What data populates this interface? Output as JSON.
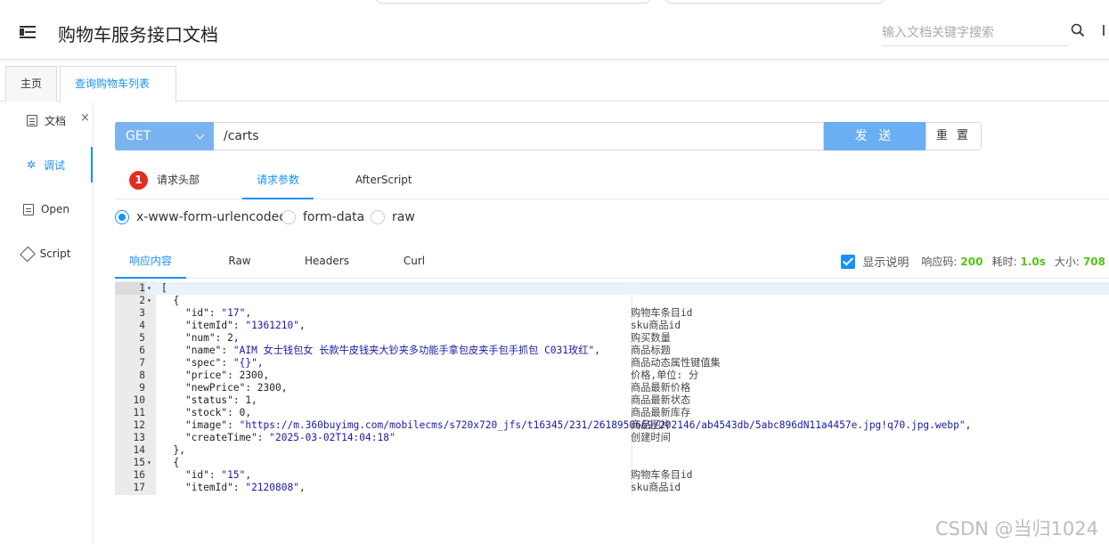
{
  "header": {
    "title": "购物车服务接口文档",
    "search_placeholder": "输入文档关键字搜索"
  },
  "tabs": {
    "home": "主页",
    "active": "查询购物车列表",
    "close": "×"
  },
  "sidebar": {
    "items": [
      {
        "label": "文档",
        "icon": "doc-icon"
      },
      {
        "label": "调试",
        "icon": "bug-icon"
      },
      {
        "label": "Open",
        "icon": "file-icon"
      },
      {
        "label": "Script",
        "icon": "cube-icon"
      }
    ]
  },
  "request": {
    "method": "GET",
    "url": "/carts",
    "send_label": "发 送",
    "reset_label": "重 置"
  },
  "subtabs": {
    "badge": "1",
    "headers": "请求头部",
    "params": "请求参数",
    "after": "AfterScript"
  },
  "body_types": {
    "urlencoded": "x-www-form-urlencoded",
    "formdata": "form-data",
    "raw": "raw"
  },
  "response_tabs": {
    "content": "响应内容",
    "raw": "Raw",
    "headers": "Headers",
    "curl": "Curl"
  },
  "response_meta": {
    "show_desc": "显示说明",
    "code_label": "响应码:",
    "code": "200",
    "time_label": "耗时:",
    "time": "1.0s",
    "size_label": "大小:",
    "size": "708"
  },
  "code_lines": [
    {
      "n": "1",
      "fold": "▾",
      "text": "[",
      "comment": ""
    },
    {
      "n": "2",
      "fold": "▾",
      "text": "  {",
      "comment": ""
    },
    {
      "n": "3",
      "fold": "",
      "text": "    \"id\": \"17\",",
      "comment": "购物车条目id"
    },
    {
      "n": "4",
      "fold": "",
      "text": "    \"itemId\": \"1361210\",",
      "comment": "sku商品id"
    },
    {
      "n": "5",
      "fold": "",
      "text": "    \"num\": 2,",
      "comment": "购买数量"
    },
    {
      "n": "6",
      "fold": "",
      "text": "    \"name\": \"AIM 女士钱包女 长款牛皮钱夹大钞夹多功能手拿包皮夹手包手抓包 C031玫红\",",
      "comment": "商品标题"
    },
    {
      "n": "7",
      "fold": "",
      "text": "    \"spec\": \"{}\",",
      "comment": "商品动态属性键值集"
    },
    {
      "n": "8",
      "fold": "",
      "text": "    \"price\": 2300,",
      "comment": "价格,单位: 分"
    },
    {
      "n": "9",
      "fold": "",
      "text": "    \"newPrice\": 2300,",
      "comment": "商品最新价格"
    },
    {
      "n": "10",
      "fold": "",
      "text": "    \"status\": 1,",
      "comment": "商品最新状态"
    },
    {
      "n": "11",
      "fold": "",
      "text": "    \"stock\": 0,",
      "comment": "商品最新库存"
    },
    {
      "n": "12",
      "fold": "",
      "text": "    \"image\": \"https://m.360buyimg.com/mobilecms/s720x720_jfs/t16345/231/2618950669/202146/ab4543db/5abc896dN11a4457e.jpg!q70.jpg.webp\",",
      "comment": "商品图片"
    },
    {
      "n": "13",
      "fold": "",
      "text": "    \"createTime\": \"2025-03-02T14:04:18\"",
      "comment": "创建时间"
    },
    {
      "n": "14",
      "fold": "",
      "text": "  },",
      "comment": ""
    },
    {
      "n": "15",
      "fold": "▾",
      "text": "  {",
      "comment": ""
    },
    {
      "n": "16",
      "fold": "",
      "text": "    \"id\": \"15\",",
      "comment": "购物车条目id"
    },
    {
      "n": "17",
      "fold": "",
      "text": "    \"itemId\": \"2120808\",",
      "comment": "sku商品id"
    }
  ],
  "watermark": "CSDN @当归1024"
}
